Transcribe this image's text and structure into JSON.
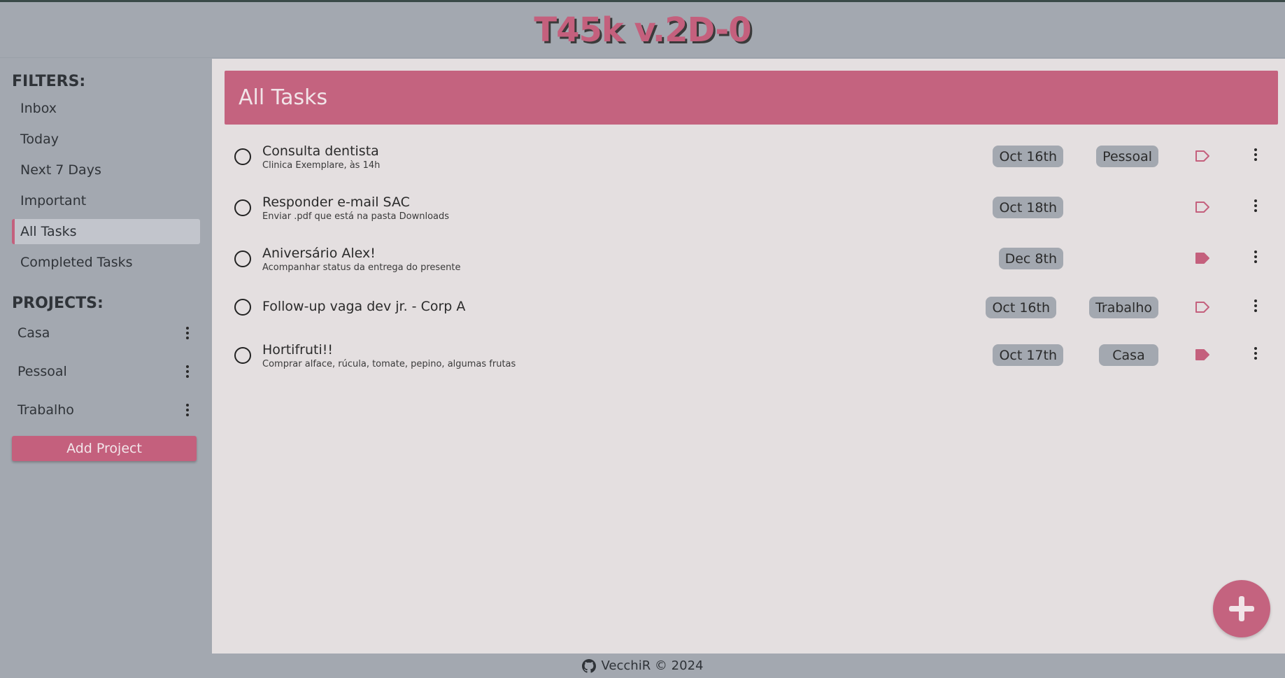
{
  "header": {
    "title": "T45k v.2D-0"
  },
  "sidebar": {
    "filters_heading": "FILTERS:",
    "filters": [
      "Inbox",
      "Today",
      "Next 7 Days",
      "Important",
      "All Tasks",
      "Completed Tasks"
    ],
    "active_filter": "All Tasks",
    "projects_heading": "PROJECTS:",
    "projects": [
      "Casa",
      "Pessoal",
      "Trabalho"
    ],
    "add_project_label": "Add Project"
  },
  "main": {
    "view_title": "All Tasks",
    "tasks": [
      {
        "title": "Consulta dentista",
        "description": "Clinica Exemplare, às 14h",
        "date": "Oct 16th",
        "project": "Pessoal",
        "important": false
      },
      {
        "title": "Responder e-mail SAC",
        "description": "Enviar .pdf que está na pasta Downloads",
        "date": "Oct 18th",
        "project": "",
        "important": false
      },
      {
        "title": "Aniversário Alex!",
        "description": "Acompanhar status da entrega do presente",
        "date": "Dec 8th",
        "project": "",
        "important": true
      },
      {
        "title": "Follow-up vaga dev jr. - Corp A",
        "description": "",
        "date": "Oct 16th",
        "project": "Trabalho",
        "important": false
      },
      {
        "title": "Hortifruti!!",
        "description": "Comprar alface, rúcula, tomate, pepino, algumas frutas",
        "date": "Oct 17th",
        "project": "Casa",
        "important": true
      }
    ],
    "fab_icon": "plus-icon"
  },
  "footer": {
    "text": "VecchiR © 2024",
    "icon": "github-icon"
  },
  "colors": {
    "accent": "#c4607d",
    "sidebar_bg": "#a3a8b0",
    "content_bg": "#e4dfe0",
    "pill_bg": "#a3a8b0"
  }
}
